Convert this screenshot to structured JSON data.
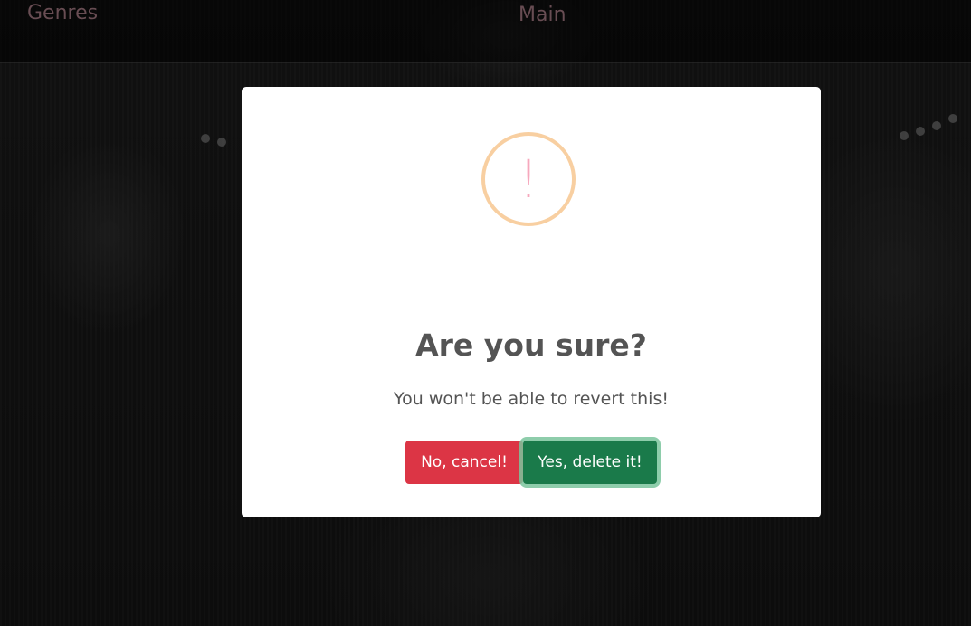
{
  "navbar": {
    "genres_label": "Genres",
    "main_label": "Main"
  },
  "dialog": {
    "icon": "exclamation-icon",
    "title": "Are you sure?",
    "text": "You won't be able to revert this!",
    "cancel_label": "No, cancel!",
    "confirm_label": "Yes, delete it!"
  },
  "colors": {
    "nav_link": "#a97c86",
    "warning_ring": "#f8cfa1",
    "warning_mark": "#f6a8bd",
    "cancel_button": "#dc3545",
    "confirm_button": "#1a7a4a"
  }
}
